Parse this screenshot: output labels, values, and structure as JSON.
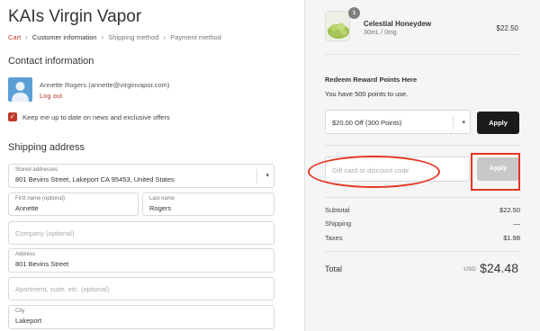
{
  "store": {
    "title": "KAIs Virgin Vapor"
  },
  "breadcrumb": {
    "cart": "Cart",
    "customer": "Customer information",
    "shipping": "Shipping method",
    "payment": "Payment method"
  },
  "contact": {
    "heading": "Contact information",
    "account": "Annette Rogers (annette@virginvapor.com)",
    "logout": "Log out",
    "newsletter": "Keep me up to date on news and exclusive offers",
    "newsletter_checked": true
  },
  "shipping": {
    "heading": "Shipping address",
    "stored_label": "Stored addresses",
    "stored_value": "801 Bevins Street, Lakeport CA 95453, United States",
    "first_label": "First name (optional)",
    "first_value": "Annette",
    "last_label": "Last name",
    "last_value": "Rogers",
    "company_placeholder": "Company (optional)",
    "address_label": "Address",
    "address_value": "801 Bevins Street",
    "apt_placeholder": "Apartment, suite, etc. (optional)",
    "city_label": "City",
    "city_value": "Lakeport"
  },
  "summary": {
    "product": {
      "name": "Celestial Honeydew",
      "variant": "30mL / 0mg",
      "price": "$22.50",
      "quantity": "1"
    },
    "rewards": {
      "heading": "Redeem Reward Points Here",
      "points_text": "You have 500 points to use.",
      "selected_option": "$20.00 Off (300 Points)",
      "apply": "Apply"
    },
    "discount": {
      "placeholder": "Gift card or discount code",
      "apply": "Apply"
    },
    "subtotal_label": "Subtotal",
    "subtotal_value": "$22.50",
    "shipping_label": "Shipping",
    "shipping_value": "—",
    "taxes_label": "Taxes",
    "taxes_value": "$1.98",
    "total_label": "Total",
    "currency": "USD",
    "total_value": "$24.48"
  },
  "colors": {
    "accent": "#c0392b",
    "annotation": "#e53522",
    "dark_button": "#1a1a1a"
  },
  "icons": [
    "avatar-icon",
    "checkmark-icon",
    "chevron-right-icon",
    "chevron-down-icon"
  ]
}
